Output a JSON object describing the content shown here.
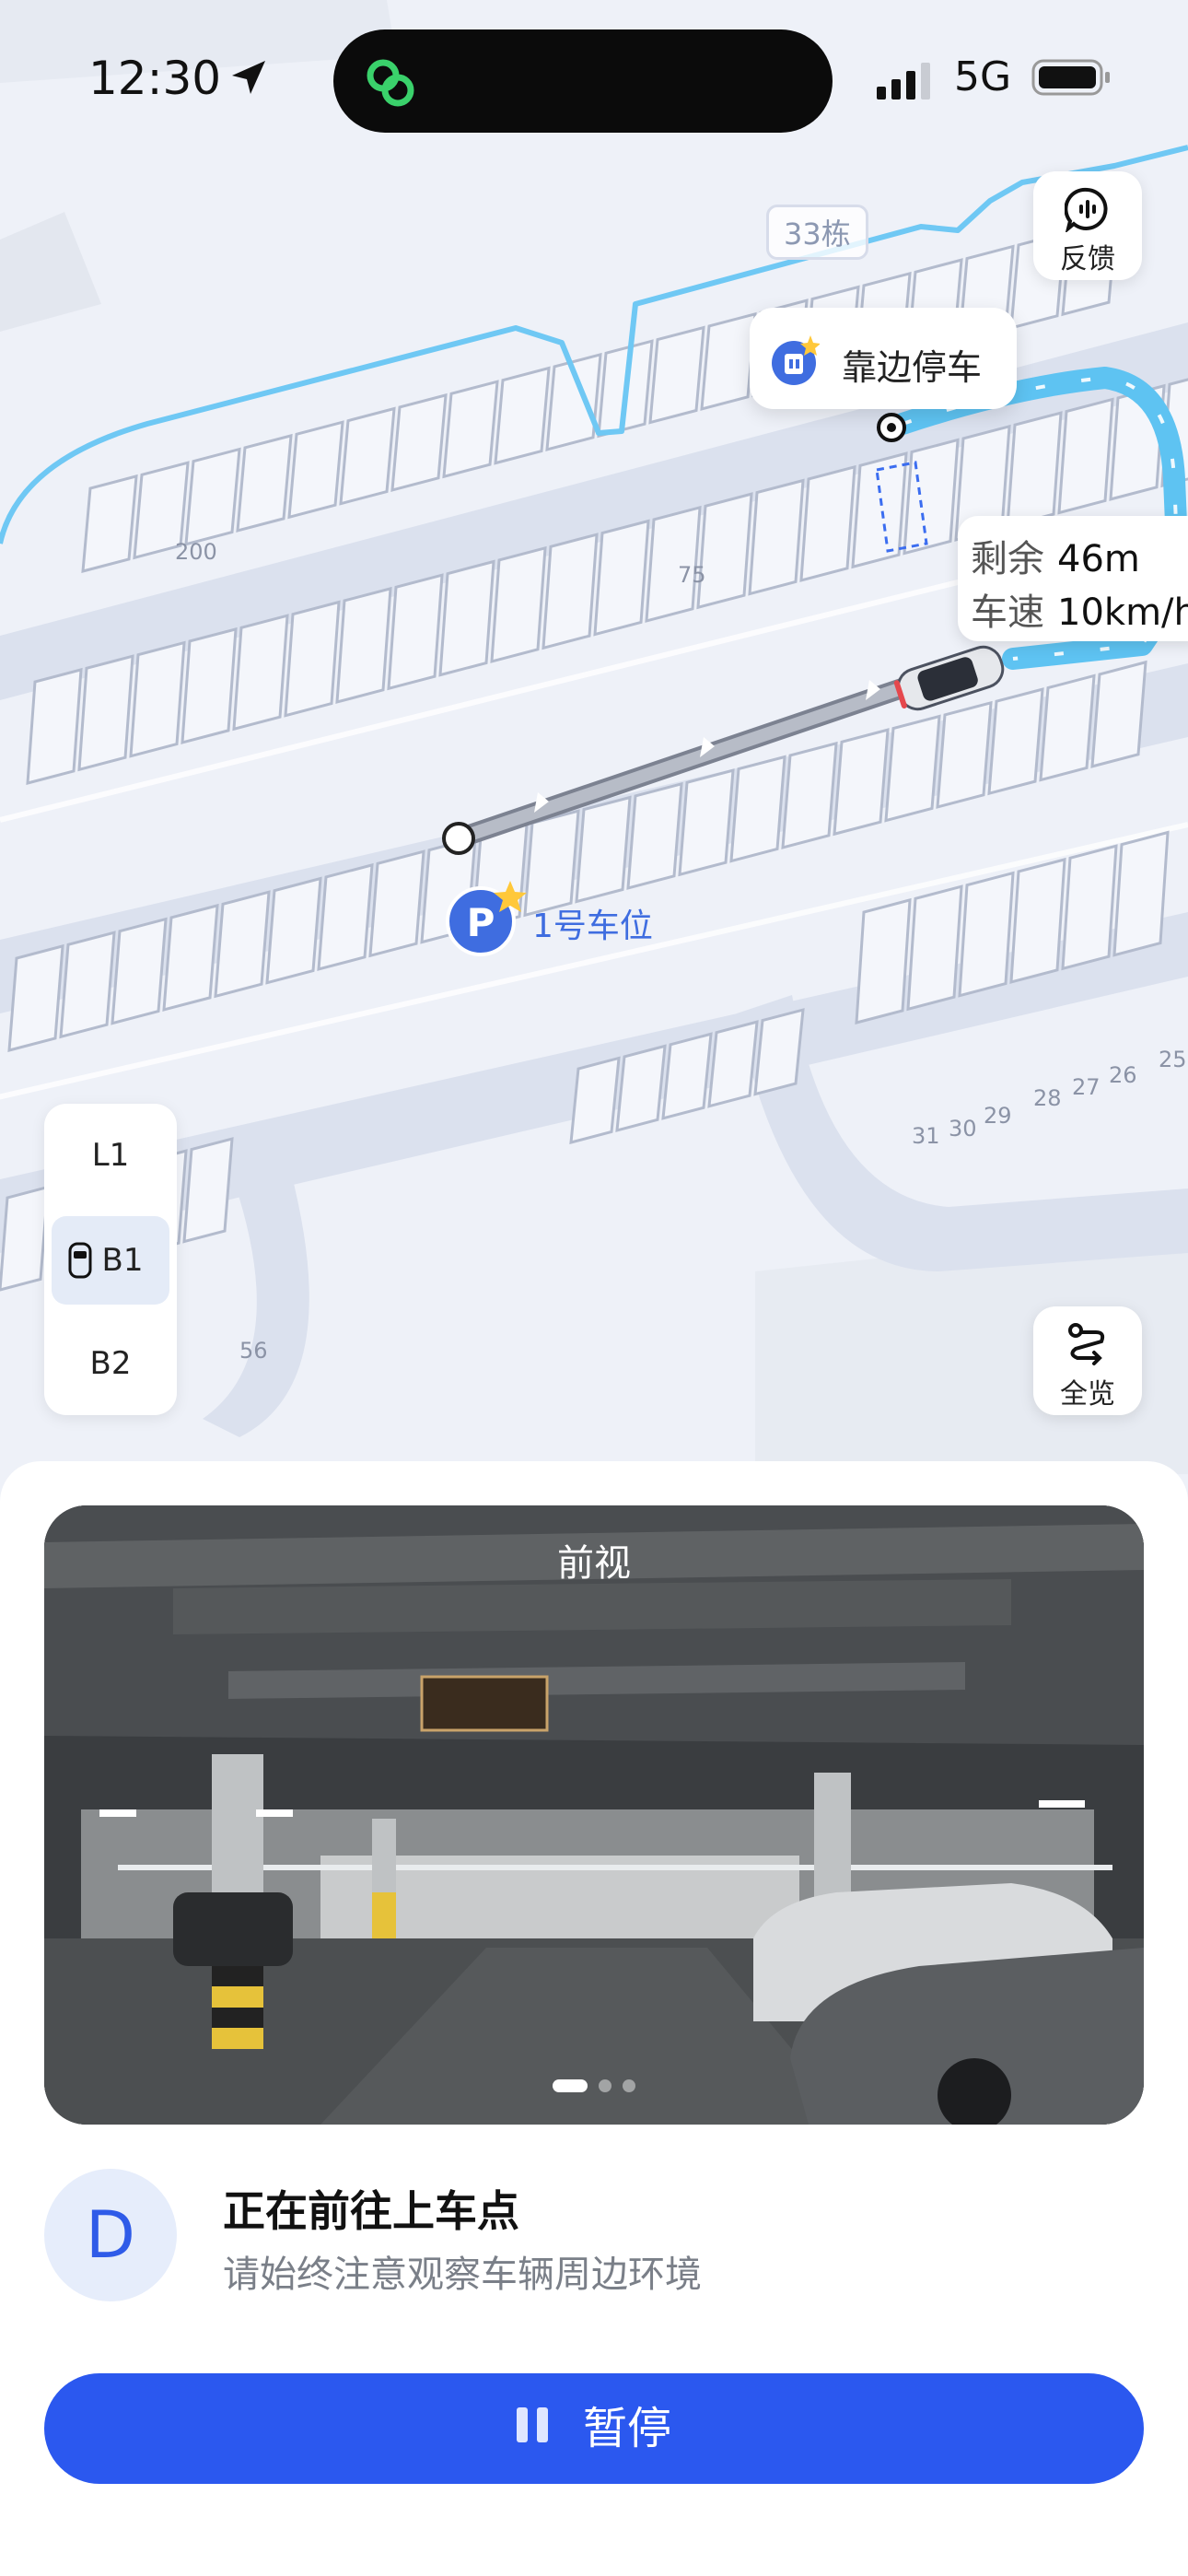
{
  "status_bar": {
    "time": "12:30",
    "network": "5G"
  },
  "map": {
    "building_label": "33栋",
    "lot_numbers": [
      "200",
      "75",
      "56",
      "31",
      "30",
      "29",
      "28",
      "27",
      "26",
      "25"
    ],
    "feedback_label": "反馈",
    "pullover_label": "靠边停车",
    "remaining_key": "剩余",
    "remaining_value": "46m",
    "speed_key": "车速",
    "speed_value": "10km/h",
    "parking_spot_label": "1号车位",
    "overview_label": "全览",
    "floors": [
      "L1",
      "B1",
      "B2"
    ],
    "active_floor": "B1",
    "route_color": "#5ec3f2"
  },
  "camera": {
    "title": "前视",
    "page_count": 3,
    "active_page": 1
  },
  "status": {
    "gear": "D",
    "title": "正在前往上车点",
    "subtitle": "请始终注意观察车辆周边环境"
  },
  "action": {
    "pause_label": "暂停",
    "color": "#2b58ef"
  }
}
